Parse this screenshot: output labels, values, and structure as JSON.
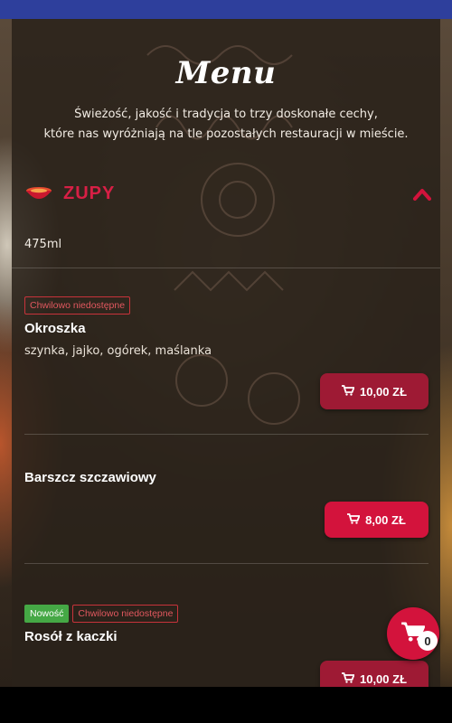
{
  "header": {
    "title": "Menu",
    "intro_line1": "Świeżość, jakość i tradycja to trzy doskonałe cechy,",
    "intro_line2": "które nas wyróżniają na tle pozostałych restauracji w mieście."
  },
  "category": {
    "label": "ZUPY",
    "icon": "soup-bowl-icon",
    "toggle_icon": "chevron-up-icon",
    "portion": "475ml"
  },
  "dishes": [
    {
      "tags": [
        "Chwilowo niedostępne"
      ],
      "name": "Okroszka",
      "description": "szynka, jajko, ogórek, maślanka",
      "price": "10,00 ZŁ",
      "available": false
    },
    {
      "tags": [],
      "name": "Barszcz szczawiowy",
      "description": "",
      "price": "8,00 ZŁ",
      "available": true
    },
    {
      "tags_new": "Nowość",
      "tags": [
        "Chwilowo niedostępne"
      ],
      "name": "Rosół z kaczki",
      "description": "",
      "price": "10,00 ZŁ",
      "available": false
    }
  ],
  "cart": {
    "count": "0",
    "icon": "cart-icon"
  },
  "colors": {
    "accent": "#d3133c",
    "accent_dim": "#9e1a34",
    "new_badge": "#45a845",
    "top_bar": "#2e3f9c"
  }
}
